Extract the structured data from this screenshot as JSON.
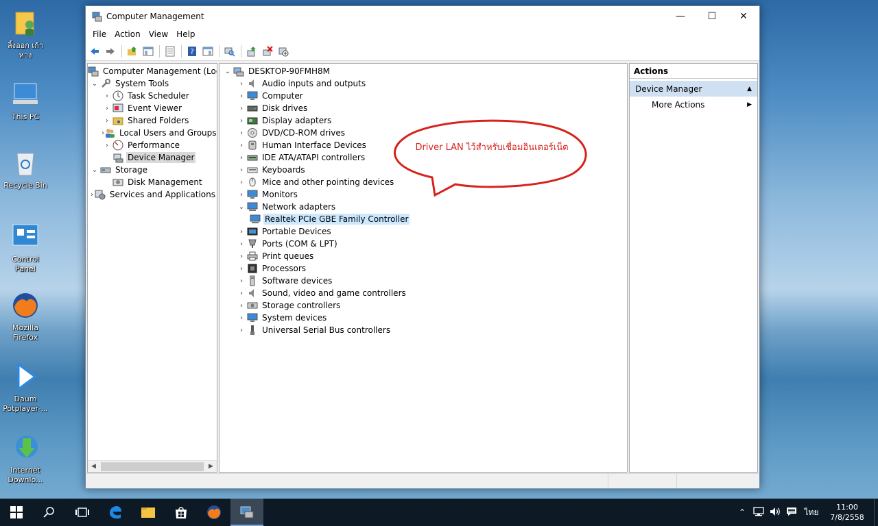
{
  "desktop": {
    "icons": [
      {
        "label": "ลิ้งออก เก้าหาง",
        "icon": "user-folder-icon"
      },
      {
        "label": "This PC",
        "icon": "this-pc-icon"
      },
      {
        "label": "Recycle Bin",
        "icon": "recycle-bin-icon"
      },
      {
        "label": "Control Panel",
        "icon": "control-panel-icon"
      },
      {
        "label": "Mozilla Firefox",
        "icon": "firefox-icon"
      },
      {
        "label": "Daum Potplayer-...",
        "icon": "potplayer-icon"
      },
      {
        "label": "Internet Downlo...",
        "icon": "idm-icon"
      }
    ]
  },
  "window": {
    "title": "Computer Management",
    "minimize": "—",
    "maximize": "☐",
    "close": "✕"
  },
  "menu": [
    "File",
    "Action",
    "View",
    "Help"
  ],
  "toolbar_icons": [
    "back-icon",
    "forward-icon",
    "up-folder-icon",
    "console-tree-icon",
    "properties-icon",
    "help-icon",
    "show-hide-icon",
    "scan-hardware-icon",
    "update-driver-icon",
    "uninstall-icon",
    "disable-icon"
  ],
  "left_tree": {
    "root": "Computer Management (Local",
    "system_tools": "System Tools",
    "task_scheduler": "Task Scheduler",
    "event_viewer": "Event Viewer",
    "shared_folders": "Shared Folders",
    "local_users": "Local Users and Groups",
    "performance": "Performance",
    "device_manager": "Device Manager",
    "storage": "Storage",
    "disk_management": "Disk Management",
    "services": "Services and Applications"
  },
  "device_tree": {
    "root": "DESKTOP-90FMH8M",
    "categories": [
      "Audio inputs and outputs",
      "Computer",
      "Disk drives",
      "Display adapters",
      "DVD/CD-ROM drives",
      "Human Interface Devices",
      "IDE ATA/ATAPI controllers",
      "Keyboards",
      "Mice and other pointing devices",
      "Monitors",
      "Network adapters",
      "Portable Devices",
      "Ports (COM & LPT)",
      "Print queues",
      "Processors",
      "Software devices",
      "Sound, video and game controllers",
      "Storage controllers",
      "System devices",
      "Universal Serial Bus controllers"
    ],
    "network_child": "Realtek PCIe GBE Family Controller"
  },
  "callout": {
    "text": "Driver LAN ไว้สำหรับเชื่อมอินเตอร์เน็ต",
    "color": "#d6231c"
  },
  "actions": {
    "header": "Actions",
    "section": "Device Manager",
    "more": "More Actions"
  },
  "taskbar": {
    "tray_lang": "ไทย",
    "time": "11:00",
    "date": "7/8/2558"
  }
}
